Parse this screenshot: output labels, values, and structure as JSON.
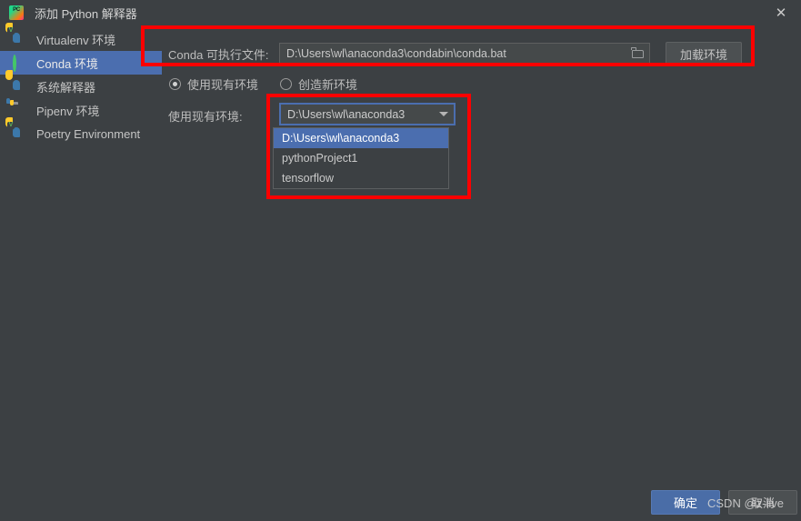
{
  "window": {
    "title": "添加 Python 解释器",
    "app_icon": "pycharm-icon",
    "close_label": "✕"
  },
  "sidebar": {
    "items": [
      {
        "label": "Virtualenv 环境",
        "icon": "python-virtualenv-icon",
        "selected": false
      },
      {
        "label": "Conda 环境",
        "icon": "conda-ring-icon",
        "selected": true
      },
      {
        "label": "系统解释器",
        "icon": "python-icon",
        "selected": false
      },
      {
        "label": "Pipenv 环境",
        "icon": "folder-python-icon",
        "selected": false
      },
      {
        "label": "Poetry Environment",
        "icon": "python-poetry-icon",
        "selected": false
      }
    ]
  },
  "main": {
    "conda_exec": {
      "label": "Conda 可执行文件:",
      "value": "D:\\Users\\wl\\anaconda3\\condabin\\conda.bat",
      "browse_icon": "folder-open-icon",
      "load_button": "加载环境"
    },
    "mode_radios": [
      {
        "label": "使用现有环境",
        "checked": true
      },
      {
        "label": "创造新环境",
        "checked": false
      }
    ],
    "existing_env": {
      "label": "使用现有环境:",
      "value": "D:\\Users\\wl\\anaconda3",
      "arrow_icon": "chevron-down-icon",
      "options": [
        {
          "label": "D:\\Users\\wl\\anaconda3",
          "selected": true
        },
        {
          "label": "pythonProject1",
          "selected": false
        },
        {
          "label": "tensorflow",
          "selected": false
        }
      ]
    }
  },
  "footer": {
    "ok_label": "确定",
    "cancel_label": "取消"
  },
  "watermark": "CSDN @z-live",
  "colors": {
    "background": "#3c4043",
    "selection": "#4b6eaf",
    "annotation": "#fe0000",
    "field_bg": "#45494a",
    "primary_button": "#4a6da7"
  }
}
